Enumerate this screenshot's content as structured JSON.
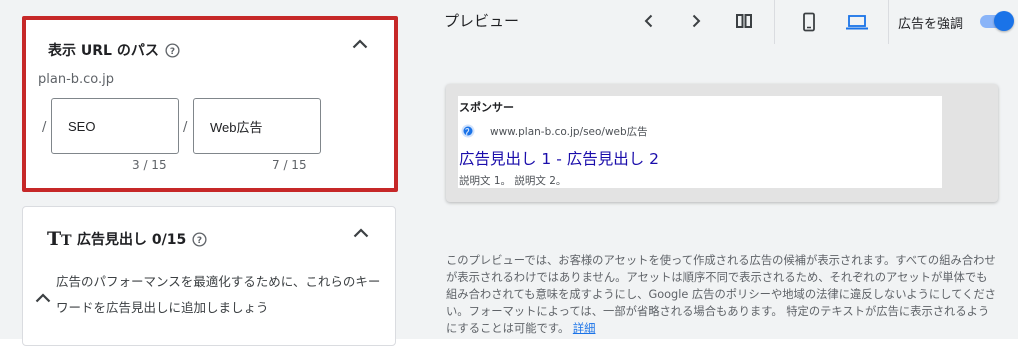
{
  "path_card": {
    "title": "表示 URL のパス",
    "domain": "plan-b.co.jp",
    "path1": {
      "value": "SEO",
      "count": "3 / 15"
    },
    "path2": {
      "value": "Web広告",
      "count": "7 / 15"
    },
    "separator": "/"
  },
  "headline_card": {
    "icon_big": "T",
    "icon_small": "T",
    "title": "広告見出し 0/15",
    "hint": "広告のパフォーマンスを最適化するために、これらのキーワードを広告見出しに追加しましょう"
  },
  "preview": {
    "title": "プレビュー",
    "emphasize_label": "広告を強調",
    "emphasize_on": true,
    "ad": {
      "sponsor": "スポンサー",
      "url": "www.plan-b.co.jp/seo/web広告",
      "headline": "広告見出し 1 - 広告見出し 2",
      "description": "説明文 1。 説明文 2。"
    },
    "disclaimer": "このプレビューでは、お客様のアセットを使って作成される広告の候補が表示されます。すべての組み合わせが表示されるわけではありません。アセットは順序不同で表示されるため、それぞれのアセットが単体でも組み合わされても意味を成すようにし、Google 広告のポリシーや地域の法律に違反しないようにしてください。フォーマットによっては、一部が省略される場合もあります。 特定のテキストが広告に表示されるようにすることは可能です。",
    "detail_link": "詳細"
  },
  "colors": {
    "highlight_border": "#c62828",
    "accent": "#1a73e8",
    "ad_headline": "#1a0dab"
  }
}
